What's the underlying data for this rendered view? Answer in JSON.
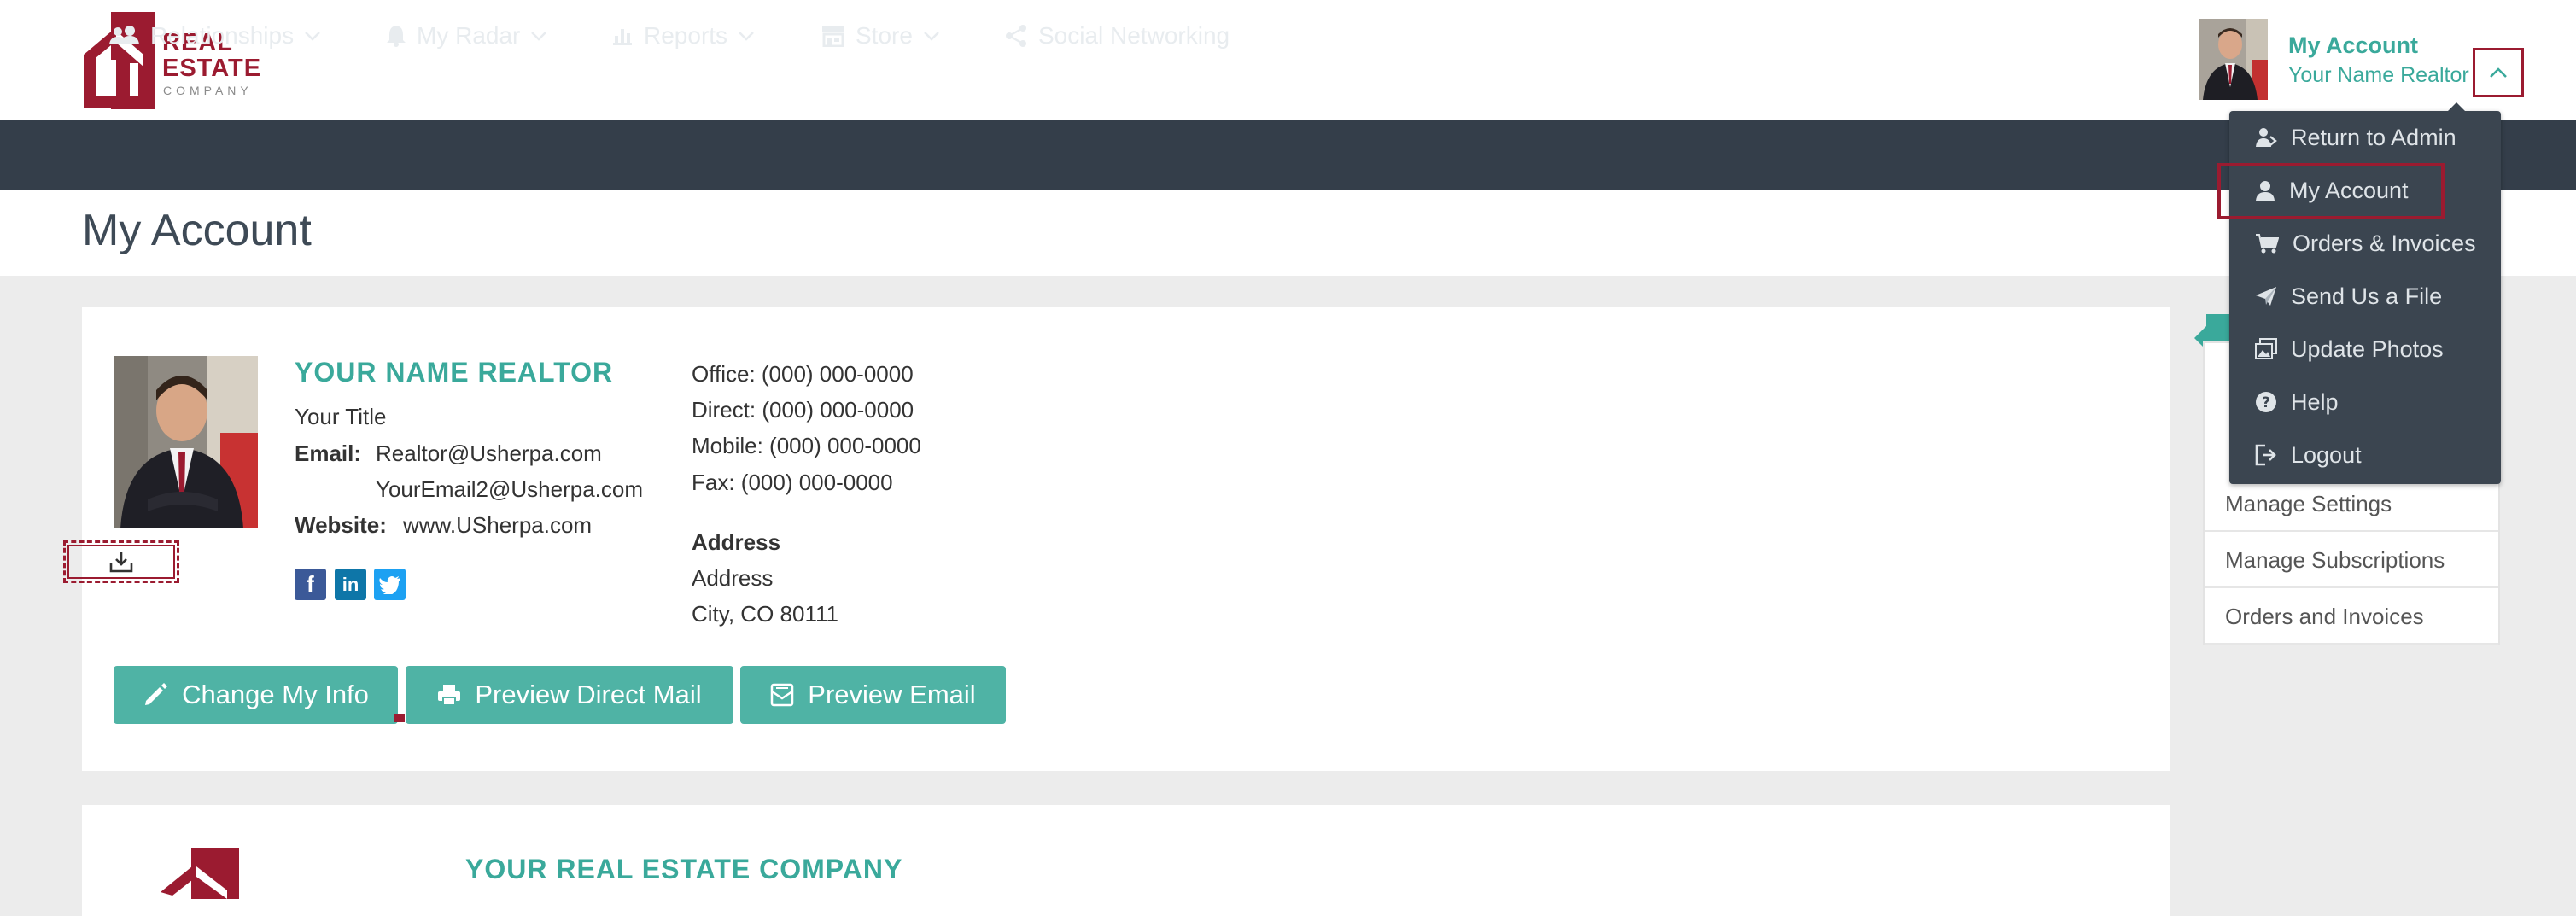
{
  "header": {
    "logo": {
      "line1": "REAL",
      "line2": "ESTATE",
      "line3": "COMPANY"
    },
    "account": {
      "title": "My Account",
      "subtitle": "Your Name Realtor"
    }
  },
  "nav": {
    "items": [
      {
        "label": "Relationships",
        "icon": "people-icon",
        "has_dropdown": true
      },
      {
        "label": "My Radar",
        "icon": "bell-icon",
        "has_dropdown": true
      },
      {
        "label": "Reports",
        "icon": "bar-chart-icon",
        "has_dropdown": true
      },
      {
        "label": "Store",
        "icon": "store-icon",
        "has_dropdown": true
      },
      {
        "label": "Social Networking",
        "icon": "share-icon",
        "has_dropdown": false
      }
    ]
  },
  "page": {
    "title": "My Account"
  },
  "profile": {
    "name": "YOUR NAME REALTOR",
    "title": "Your Title",
    "email_label": "Email:",
    "email1": "Realtor@Usherpa.com",
    "email2": "YourEmail2@Usherpa.com",
    "website_label": "Website:",
    "website": "www.USherpa.com",
    "office": "Office: (000) 000-0000",
    "direct": "Direct: (000) 000-0000",
    "mobile": "Mobile: (000) 000-0000",
    "fax": "Fax: (000) 000-0000",
    "address_label": "Address",
    "address_line1": "Address",
    "address_line2": "City, CO 80111",
    "social": [
      "facebook-icon",
      "linkedin-icon",
      "twitter-icon"
    ]
  },
  "actions": {
    "change_info": "Change My Info",
    "preview_mail": "Preview Direct Mail",
    "preview_email": "Preview Email"
  },
  "company": {
    "name": "YOUR REAL ESTATE COMPANY"
  },
  "side_panel": {
    "items": [
      "Manage Settings",
      "Manage Subscriptions",
      "Orders and Invoices"
    ]
  },
  "account_menu": {
    "items": [
      {
        "label": "Return to Admin",
        "icon": "user-return-icon"
      },
      {
        "label": "My Account",
        "icon": "user-icon"
      },
      {
        "label": "Orders & Invoices",
        "icon": "cart-icon"
      },
      {
        "label": "Send Us a File",
        "icon": "send-icon"
      },
      {
        "label": "Update Photos",
        "icon": "photos-icon"
      },
      {
        "label": "Help",
        "icon": "help-icon"
      },
      {
        "label": "Logout",
        "icon": "logout-icon"
      }
    ]
  },
  "colors": {
    "accent": "#3aa99b",
    "button": "#4fb3a5",
    "brand": "#9b1b30",
    "navbar": "#343e4a",
    "dropdown": "#3b4550"
  }
}
